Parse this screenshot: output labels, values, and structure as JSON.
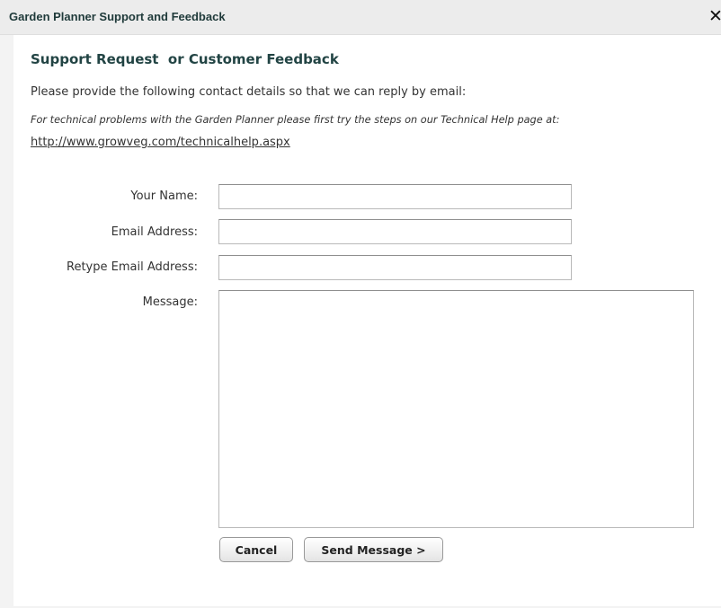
{
  "window": {
    "title": "Garden Planner Support and Feedback",
    "close_glyph": "✕"
  },
  "form": {
    "heading": "Support Request  or Customer Feedback",
    "intro": "Please provide the following contact details so that we can reply by email:",
    "tech_note": "For technical problems with the Garden Planner please first try the steps on our Technical Help page at:",
    "help_link": "http://www.growveg.com/technicalhelp.aspx",
    "fields": {
      "name_label": "Your Name:",
      "name_value": "",
      "email_label": "Email Address:",
      "email_value": "",
      "retype_label": "Retype Email Address:",
      "retype_value": "",
      "message_label": "Message:",
      "message_value": ""
    },
    "buttons": {
      "cancel": "Cancel",
      "send": "Send Message >"
    }
  }
}
